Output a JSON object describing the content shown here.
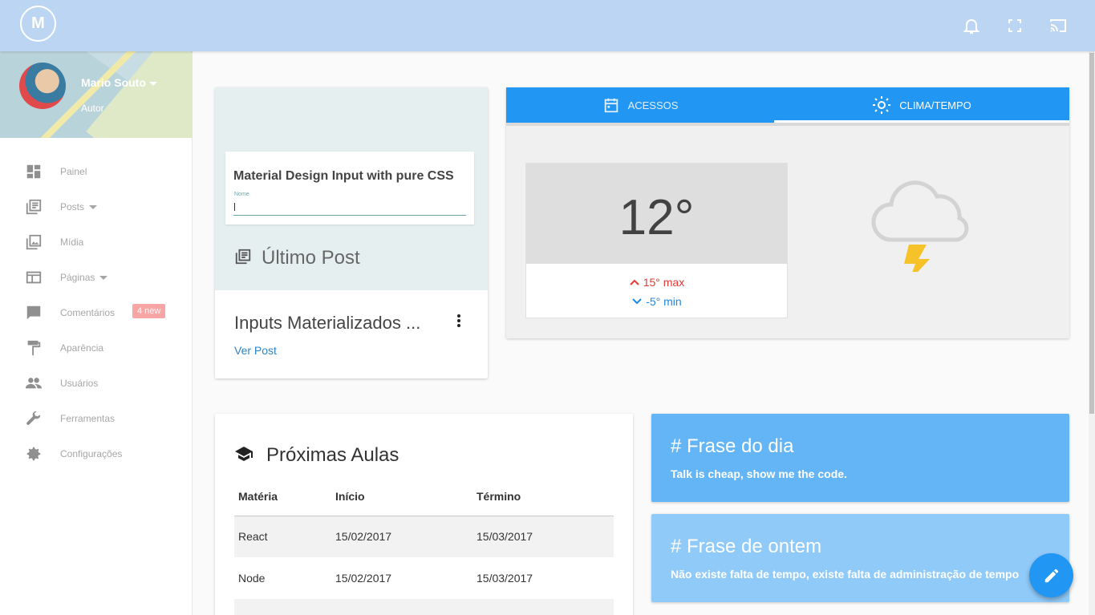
{
  "header": {
    "logo_text": "M",
    "icons": [
      "bell-icon",
      "fullscreen-icon",
      "cast-icon"
    ]
  },
  "profile": {
    "name": "Mario Souto",
    "role": "Autor"
  },
  "sidebar": {
    "items": [
      {
        "label": "Painel",
        "icon": "dashboard-icon"
      },
      {
        "label": "Posts",
        "icon": "posts-icon",
        "dropdown": true
      },
      {
        "label": "Mídia",
        "icon": "media-icon"
      },
      {
        "label": "Páginas",
        "icon": "pages-icon",
        "dropdown": true
      },
      {
        "label": "Comentários",
        "icon": "comments-icon",
        "badge": "4 new"
      },
      {
        "label": "Aparência",
        "icon": "paint-roller-icon"
      },
      {
        "label": "Usuários",
        "icon": "users-icon"
      },
      {
        "label": "Ferramentas",
        "icon": "wrench-icon"
      },
      {
        "label": "Configurações",
        "icon": "settings-icon"
      }
    ]
  },
  "last_post": {
    "preview_title": "Material Design Input with pure CSS",
    "preview_label": "Nome",
    "heading": "Último Post",
    "title": "Inputs Materializados ...",
    "link": "Ver Post"
  },
  "weather": {
    "tabs": [
      {
        "label": "ACESSOS",
        "icon": "calendar-icon"
      },
      {
        "label": "CLIMA/TEMPO",
        "icon": "sun-icon",
        "active": true
      }
    ],
    "temperature": "12°",
    "max": "15° max",
    "min": "-5° min",
    "colors": {
      "tab_bar": "#2196f3",
      "max": "#e53935",
      "min": "#1e88e5"
    }
  },
  "classes": {
    "title": "Próximas Aulas",
    "columns": [
      "Matéria",
      "Início",
      "Término"
    ],
    "rows": [
      [
        "React",
        "15/02/2017",
        "15/03/2017"
      ],
      [
        "Node",
        "15/02/2017",
        "15/03/2017"
      ]
    ]
  },
  "quotes": [
    {
      "title": "# Frase do dia",
      "text": "Talk is cheap, show me the code."
    },
    {
      "title": "# Frase de ontem",
      "text": "Não existe falta de tempo, existe falta de administração de tempo"
    }
  ],
  "fab": {
    "icon": "edit-icon"
  }
}
